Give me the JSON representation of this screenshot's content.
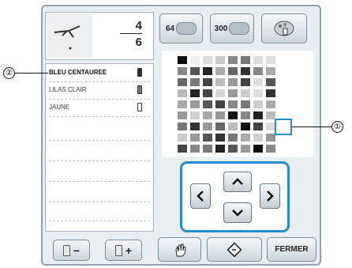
{
  "header": {
    "fraction_numerator": "4",
    "fraction_denominator": "6"
  },
  "thread_list": [
    {
      "name": "BLEU CENTAUREE",
      "spool_color": "#333333",
      "selected": true
    },
    {
      "name": "LILAS CLAIR",
      "spool_color": "#777777",
      "selected": false
    },
    {
      "name": "JAUNE",
      "spool_color": "#ffffff",
      "selected": false
    }
  ],
  "buttons": {
    "minus_label": "−",
    "plus_label": "+",
    "palette64_label": "64",
    "palette300_label": "300",
    "close_label": "FERMER"
  },
  "callouts": {
    "one": "①",
    "two": "②"
  },
  "icons": {
    "hand": "hand-icon",
    "reset": "reset-icon",
    "palette": "palette-icon",
    "arrows": [
      "chevron-left-icon",
      "chevron-up-icon",
      "chevron-down-icon",
      "chevron-right-icon"
    ]
  },
  "colors": {
    "accent": "#1e8ed0"
  },
  "palette_grid_shades": [
    [
      "#111111",
      "#eeeeee",
      "#dddddd",
      "#cccccc",
      "#888888",
      "#777777",
      "#dddddd",
      "#e0e0e0"
    ],
    [
      "#888888",
      "#555555",
      "#222222",
      "#aaaaaa",
      "#666666",
      "#333333",
      "#888888",
      "#aaaaaa"
    ],
    [
      "#666666",
      "#777777",
      "#444444",
      "#bbbbbb",
      "#999999",
      "#444444",
      "#dddddd",
      "#555555"
    ],
    [
      "#bbbbbb",
      "#222222",
      "#444444",
      "#d6d6d6",
      "#999999",
      "#cccccc",
      "#dddddd",
      "#333333"
    ],
    [
      "#aaaaaa",
      "#999999",
      "#555555",
      "#444444",
      "#888888",
      "#777777",
      "#cccccc",
      "#aaaaaa"
    ],
    [
      "#999999",
      "#d0d0d0",
      "#aaaaaa",
      "#999999",
      "#111111",
      "#888888",
      "#222222",
      "#bbbbbb"
    ],
    [
      "#777777",
      "#333333",
      "#999999",
      "#666666",
      "#bbbbbb",
      "#111111",
      "#444444",
      "#dddddd"
    ],
    [
      "#cccccc",
      "#999999",
      "#555555",
      "#333333",
      "#777777",
      "#aaaaaa",
      "#d0d0d0",
      "#999999"
    ],
    [
      "#444444",
      "#888888",
      "#777777",
      "#222222",
      "#555555",
      "#999999",
      "#111111",
      "#888888"
    ]
  ]
}
